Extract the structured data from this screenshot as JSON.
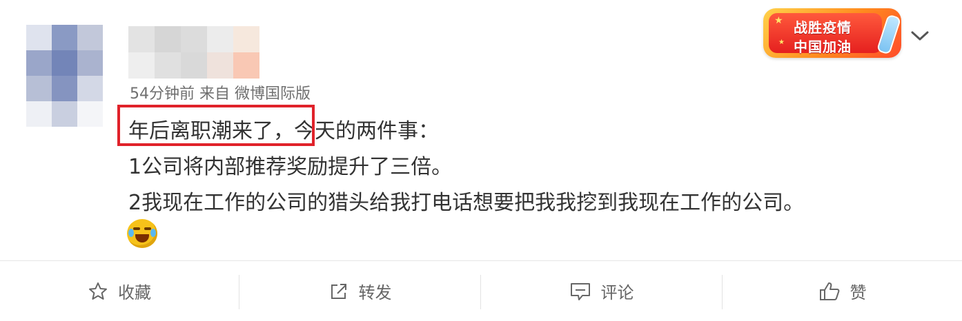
{
  "post": {
    "meta": "54分钟前 来自 微博国际版",
    "lines": [
      {
        "highlight": "年后离职潮来了，",
        "rest": "今天的两件事："
      },
      {
        "text": "1公司将内部推荐奖励提升了三倍。"
      },
      {
        "text": "2我现在工作的公司的猎头给我打电话想要把我我挖到我现在工作的公司。"
      }
    ],
    "emoji": "laughing-crying-emoji"
  },
  "badge": {
    "line1": "战胜疫情",
    "line2": "中国加油"
  },
  "actions": [
    {
      "label": "收藏",
      "icon": "star-icon"
    },
    {
      "label": "转发",
      "icon": "share-icon"
    },
    {
      "label": "评论",
      "icon": "comment-icon"
    },
    {
      "label": "赞",
      "icon": "thumbs-up-icon"
    }
  ],
  "colors": {
    "highlight_border": "#e0222a",
    "meta_text": "#6f6f6f",
    "body_text": "#333333"
  }
}
